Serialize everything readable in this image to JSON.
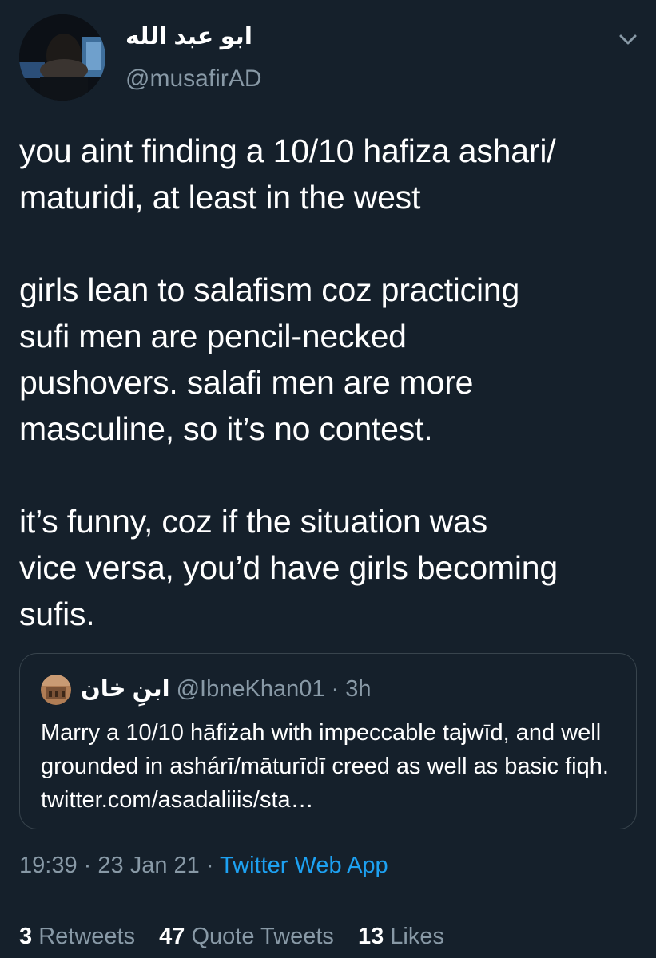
{
  "author": {
    "display_name": "ابو عبد الله",
    "handle": "@musafirAD"
  },
  "tweet": {
    "text": "you aint finding a 10/10 hafiza ashari/\nmaturidi, at least in the west\n\ngirls lean to salafism coz practicing\nsufi men are pencil-necked\npushovers. salafi men are more\nmasculine, so it’s no contest.\n\nit’s funny, coz if the situation was\nvice versa, you’d have girls becoming\nsufis."
  },
  "quoted_tweet": {
    "display_name": "ابنِ خان",
    "handle": "@IbneKhan01",
    "separator": "·",
    "time": "3h",
    "text": "Marry a 10/10 hāfiżah with impeccable tajwīd, and well grounded in ashárī/māturīdī creed as well as basic fiqh. twitter.com/asadaliiis/sta…"
  },
  "meta": {
    "time": "19:39",
    "sep1": "·",
    "date": "23 Jan 21",
    "sep2": "·",
    "source": "Twitter Web App"
  },
  "stats": {
    "retweets_count": "3",
    "retweets_label": "Retweets",
    "quotes_count": "47",
    "quotes_label": "Quote Tweets",
    "likes_count": "13",
    "likes_label": "Likes"
  },
  "icons": {
    "menu": "chevron-down-icon"
  },
  "colors": {
    "background": "#15202b",
    "text_primary": "#ffffff",
    "text_secondary": "#8899a6",
    "link": "#1da1f2",
    "border": "#38444d"
  }
}
